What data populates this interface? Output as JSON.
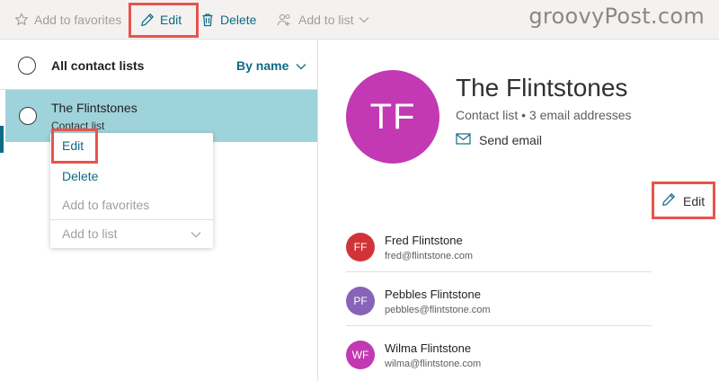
{
  "toolbar": {
    "add_to_favorites": "Add to favorites",
    "edit": "Edit",
    "delete": "Delete",
    "add_to_list": "Add to list"
  },
  "brand": "groovyPost.com",
  "left": {
    "header_title": "All contact lists",
    "sort_label": "By name",
    "selected_item": {
      "name": "The Flintstones",
      "subtitle": "Contact list"
    },
    "context_menu": {
      "edit": "Edit",
      "delete": "Delete",
      "add_to_favorites": "Add to favorites",
      "add_to_list": "Add to list"
    }
  },
  "detail": {
    "initials": "TF",
    "name": "The Flintstones",
    "subtitle": "Contact list • 3 email addresses",
    "send_email": "Send email",
    "edit": "Edit",
    "members": [
      {
        "initials": "FF",
        "name": "Fred Flintstone",
        "email": "fred@flintstone.com",
        "color": "#d13438"
      },
      {
        "initials": "PF",
        "name": "Pebbles Flintstone",
        "email": "pebbles@flintstone.com",
        "color": "#8764b8"
      },
      {
        "initials": "WF",
        "name": "Wilma Flintstone",
        "email": "wilma@flintstone.com",
        "color": "#c239b3"
      }
    ]
  },
  "colors": {
    "accent": "#0f6a85",
    "selected_row": "#9fd3dc",
    "highlight_box": "#e8544b",
    "big_avatar": "#c239b3"
  }
}
